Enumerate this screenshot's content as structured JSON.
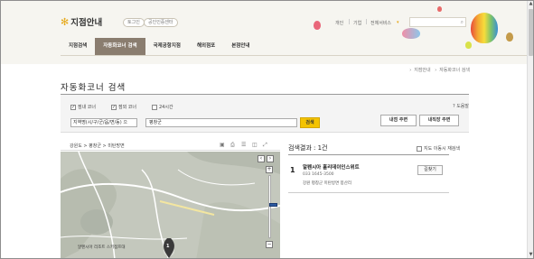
{
  "header": {
    "logo_text": "지점안내",
    "pill_1": "토그인",
    "pill_2": "공인인증센터",
    "util_1": "개인",
    "util_2": "기업",
    "util_3": "전체서비스",
    "search_placeholder": ""
  },
  "gnb": {
    "items": [
      {
        "label": "지점검색"
      },
      {
        "label": "자동화코너 검색"
      },
      {
        "label": "국제공항지점"
      },
      {
        "label": "해외점포"
      },
      {
        "label": "본점안내"
      }
    ],
    "active_index": 1
  },
  "breadcrumb": {
    "home": "지점안내",
    "current": "자동화코너 검색"
  },
  "page_title": "자동화코너 검색",
  "filters": {
    "checkbox_1": {
      "label": "점내 코너",
      "checked": true
    },
    "checkbox_2": {
      "label": "점외 코너",
      "checked": true
    },
    "checkbox_3": {
      "label": "24시간",
      "checked": false
    },
    "help_label": "? 도움말",
    "region_select": "지역명(시/구/군/읍/면/동) 으",
    "query_value": "평창군 ",
    "search_button": "검색",
    "btn_nearby_1": "내점 주변",
    "btn_nearby_2": "내직장 주변"
  },
  "map": {
    "location_path": "강원도 > 평창군 > 미탄방면",
    "label_block": "알펜시아 리조트 스키점프대",
    "marker_number": "1",
    "zoom_plus": "+",
    "zoom_minus": "−"
  },
  "results": {
    "title": "검색결과 : 1건",
    "map_move_checkbox": "지도 이동시 재검색",
    "items": [
      {
        "number": "1",
        "name": "알펜시아 홀리데이인스위트",
        "phone": "033 1645-3500",
        "address": "강원 평창군 미탄방면 봉산리",
        "action": "길찾기"
      }
    ]
  },
  "colors": {
    "accent": "#f4c300",
    "active_tab": "#8a7d6f",
    "header_bg": "#f6f5f0"
  }
}
